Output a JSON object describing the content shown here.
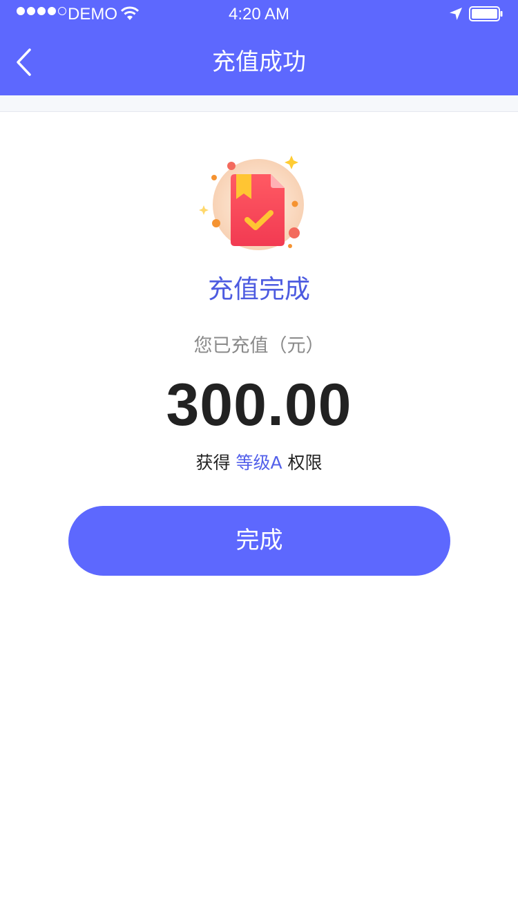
{
  "status_bar": {
    "carrier": "DEMO",
    "time": "4:20 AM",
    "signal_icon": "signal-dots-icon",
    "wifi_icon": "wifi-icon",
    "location_icon": "location-arrow-icon",
    "battery_icon": "battery-icon"
  },
  "nav": {
    "title": "充值成功",
    "back_icon": "chevron-left-icon"
  },
  "result": {
    "illustration_icon": "recharge-success-book-icon",
    "title": "充值完成",
    "amount_label": "您已充值（元）",
    "amount": "300.00",
    "privilege_prefix": "获得",
    "privilege_level": "等级A",
    "privilege_suffix": "权限"
  },
  "actions": {
    "done_label": "完成"
  },
  "colors": {
    "primary": "#5d68fe",
    "accent_text": "#4d5be0",
    "amount_text": "#222222",
    "muted_text": "#8a8a8a"
  }
}
